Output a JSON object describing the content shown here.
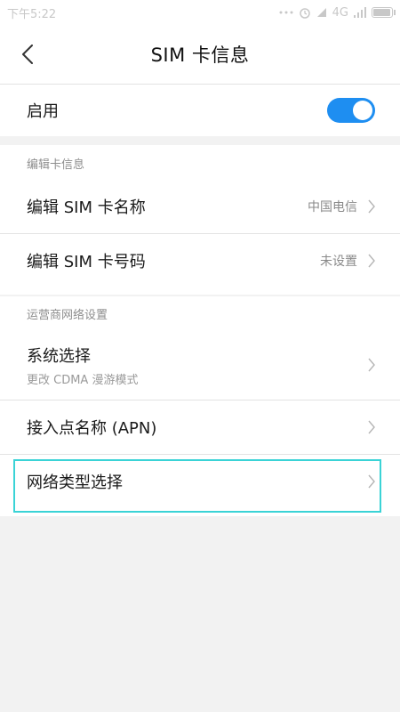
{
  "status": {
    "time": "下午5:22",
    "network": "4G"
  },
  "header": {
    "title": "SIM  卡信息"
  },
  "enable": {
    "label": "启用",
    "on": true
  },
  "edit_section": {
    "header": "编辑卡信息",
    "items": [
      {
        "label": "编辑 SIM 卡名称",
        "value": "中国电信"
      },
      {
        "label": "编辑 SIM 卡号码",
        "value": "未设置"
      }
    ]
  },
  "carrier_section": {
    "header": "运营商网络设置",
    "items": [
      {
        "label": "系统选择",
        "sublabel": "更改 CDMA 漫游模式"
      },
      {
        "label": "接入点名称 (APN)"
      },
      {
        "label": "网络类型选择"
      }
    ]
  },
  "colors": {
    "accent": "#1e8ef1",
    "highlight": "#3ad3d6"
  },
  "icons": [
    "back-arrow-icon",
    "chevron-right-icon",
    "alarm-icon",
    "signal-icon",
    "battery-icon"
  ]
}
